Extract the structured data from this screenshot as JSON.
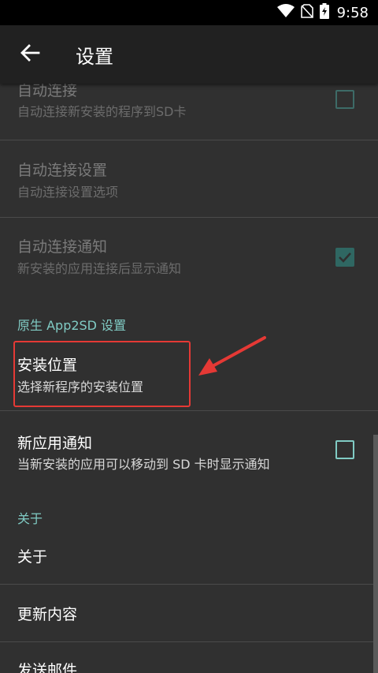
{
  "status_bar": {
    "time": "9:58",
    "icons": [
      "wifi-icon",
      "no-sim-icon",
      "battery-charging-icon"
    ]
  },
  "toolbar": {
    "back_icon": "arrow-back-icon",
    "title": "设置"
  },
  "settings": {
    "auto_connect": {
      "title": "自动连接",
      "summary": "自动连接新安装的程序到SD卡",
      "checked": false,
      "enabled": false
    },
    "auto_connect_settings": {
      "title": "自动连接设置",
      "summary": "自动连接设置选项",
      "enabled": false
    },
    "auto_connect_notify": {
      "title": "自动连接通知",
      "summary": "新安装的应用连接后显示通知",
      "checked": true,
      "enabled": false
    },
    "section_native": "原生 App2SD 设置",
    "install_location": {
      "title": "安装位置",
      "summary": "选择新程序的安装位置"
    },
    "new_app_notify": {
      "title": "新应用通知",
      "summary": "当新安装的应用可以移动到 SD 卡时显示通知",
      "checked": false
    },
    "section_about": "关于",
    "about": {
      "title": "关于"
    },
    "changelog": {
      "title": "更新内容"
    },
    "send_mail": {
      "title": "发送邮件"
    }
  },
  "colors": {
    "accent": "#80cbc4",
    "annotation": "#e53935",
    "background": "#303030",
    "toolbar": "#212121"
  }
}
